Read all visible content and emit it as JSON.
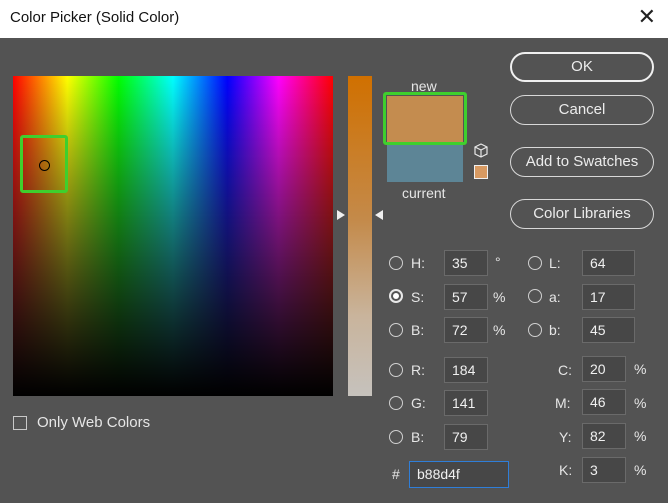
{
  "window": {
    "title": "Color Picker (Solid Color)"
  },
  "icons": {
    "close": "close-icon",
    "cube": "cube-icon"
  },
  "preview": {
    "new_label": "new",
    "current_label": "current",
    "new_color": "#c48c4f",
    "current_color": "#5d8596"
  },
  "buttons": {
    "ok": "OK",
    "cancel": "Cancel",
    "add_to_swatches": "Add to Swatches",
    "color_libraries": "Color Libraries"
  },
  "hsb": {
    "h": {
      "label": "H:",
      "value": "35",
      "unit": "°"
    },
    "s": {
      "label": "S:",
      "value": "57",
      "unit": "%",
      "selected": true
    },
    "b": {
      "label": "B:",
      "value": "72",
      "unit": "%"
    }
  },
  "rgb": {
    "r": {
      "label": "R:",
      "value": "184"
    },
    "g": {
      "label": "G:",
      "value": "141"
    },
    "b": {
      "label": "B:",
      "value": "79"
    }
  },
  "lab": {
    "l": {
      "label": "L:",
      "value": "64"
    },
    "a": {
      "label": "a:",
      "value": "17"
    },
    "b": {
      "label": "b:",
      "value": "45"
    }
  },
  "cmyk": {
    "c": {
      "label": "C:",
      "value": "20",
      "unit": "%"
    },
    "m": {
      "label": "M:",
      "value": "46",
      "unit": "%"
    },
    "y": {
      "label": "Y:",
      "value": "82",
      "unit": "%"
    },
    "k": {
      "label": "K:",
      "value": "3",
      "unit": "%"
    }
  },
  "hex": {
    "label": "#",
    "value": "b88d4f"
  },
  "only_web_colors": {
    "label": "Only Web Colors",
    "checked": false
  }
}
